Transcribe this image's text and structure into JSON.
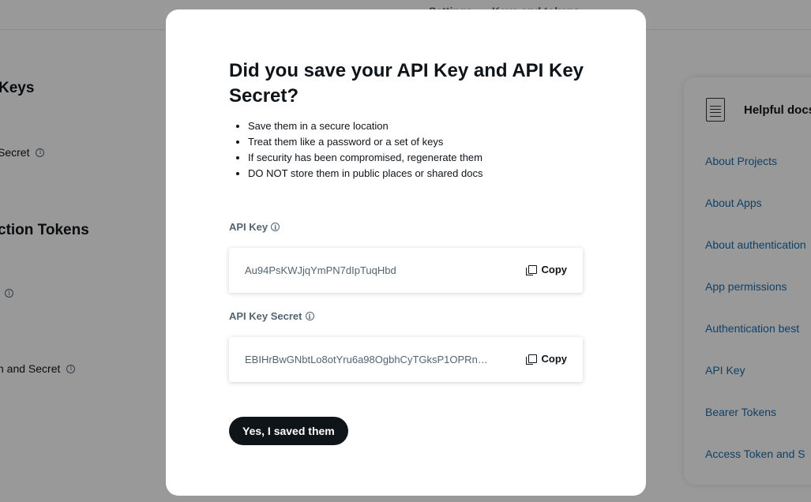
{
  "background": {
    "breadcrumb": [
      "Settings",
      "Keys and tokens"
    ],
    "headings": {
      "keys": "Keys",
      "tokens": "ction Tokens"
    },
    "rows": {
      "secret": "Secret",
      "token_info": "",
      "token_and_secret": "n and Secret"
    },
    "side_card": {
      "title": "Helpful docs",
      "links": [
        "About Projects",
        "About Apps",
        "About authentication",
        "App permissions",
        "Authentication best",
        "API Key",
        "Bearer Tokens",
        "Access Token and S"
      ]
    }
  },
  "modal": {
    "title": "Did you save your API Key and API Key Secret?",
    "bullets": [
      "Save them in a secure location",
      "Treat them like a password or a set of keys",
      "If security has been compromised, regenerate them",
      "DO NOT store them in public places or shared docs"
    ],
    "api_key": {
      "label": "API Key",
      "value": "Au94PsKWJjqYmPN7dIpTuqHbd",
      "copy_label": "Copy"
    },
    "api_key_secret": {
      "label": "API Key Secret",
      "value": "EBIHrBwGNbtLo8otYru6a98OgbhCyTGksP1OPRn…",
      "copy_label": "Copy"
    },
    "confirm_label": "Yes, I saved them"
  },
  "colors": {
    "overlay": "rgba(0,0,0,0.4)",
    "primary_button": "#0f1419",
    "link": "#1d6ba8"
  }
}
